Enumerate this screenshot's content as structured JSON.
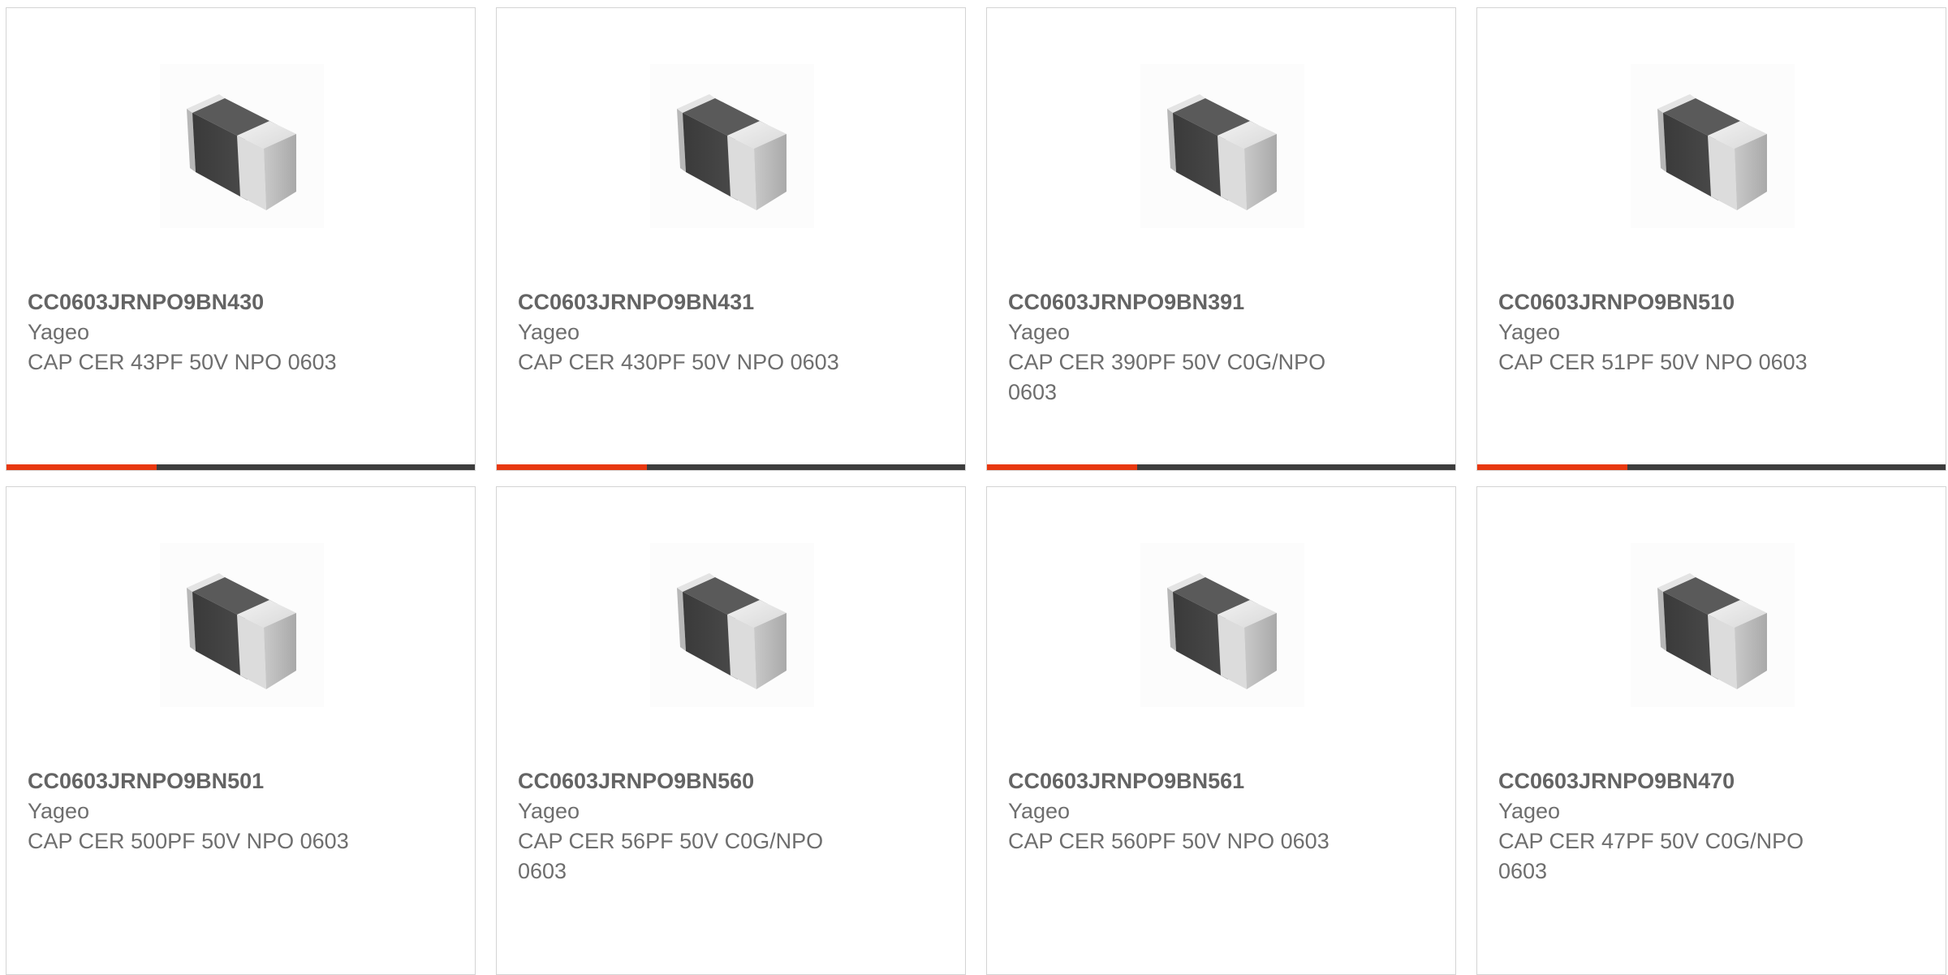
{
  "colors": {
    "accent": "#e8380f",
    "bar_track": "#3d3d3d",
    "card_border": "#d4d4d4",
    "text": "#6e6e6e"
  },
  "products": [
    {
      "part": "CC0603JRNPO9BN430",
      "brand": "Yageo",
      "desc": "CAP CER 43PF 50V NPO 0603",
      "icon": "capacitor-chip-icon",
      "progress": 0.32
    },
    {
      "part": "CC0603JRNPO9BN431",
      "brand": "Yageo",
      "desc": "CAP CER 430PF 50V NPO 0603",
      "icon": "capacitor-chip-icon",
      "progress": 0.32
    },
    {
      "part": "CC0603JRNPO9BN391",
      "brand": "Yageo",
      "desc": "CAP CER 390PF 50V C0G/NPO 0603",
      "icon": "capacitor-chip-icon",
      "progress": 0.32
    },
    {
      "part": "CC0603JRNPO9BN510",
      "brand": "Yageo",
      "desc": "CAP CER 51PF 50V NPO 0603",
      "icon": "capacitor-chip-icon",
      "progress": 0.32
    },
    {
      "part": "CC0603JRNPO9BN501",
      "brand": "Yageo",
      "desc": "CAP CER 500PF 50V NPO 0603",
      "icon": "capacitor-chip-icon"
    },
    {
      "part": "CC0603JRNPO9BN560",
      "brand": "Yageo",
      "desc": "CAP CER 56PF 50V C0G/NPO 0603",
      "icon": "capacitor-chip-icon"
    },
    {
      "part": "CC0603JRNPO9BN561",
      "brand": "Yageo",
      "desc": "CAP CER 560PF 50V NPO 0603",
      "icon": "capacitor-chip-icon"
    },
    {
      "part": "CC0603JRNPO9BN470",
      "brand": "Yageo",
      "desc": "CAP CER 47PF 50V C0G/NPO 0603",
      "icon": "capacitor-chip-icon"
    }
  ]
}
